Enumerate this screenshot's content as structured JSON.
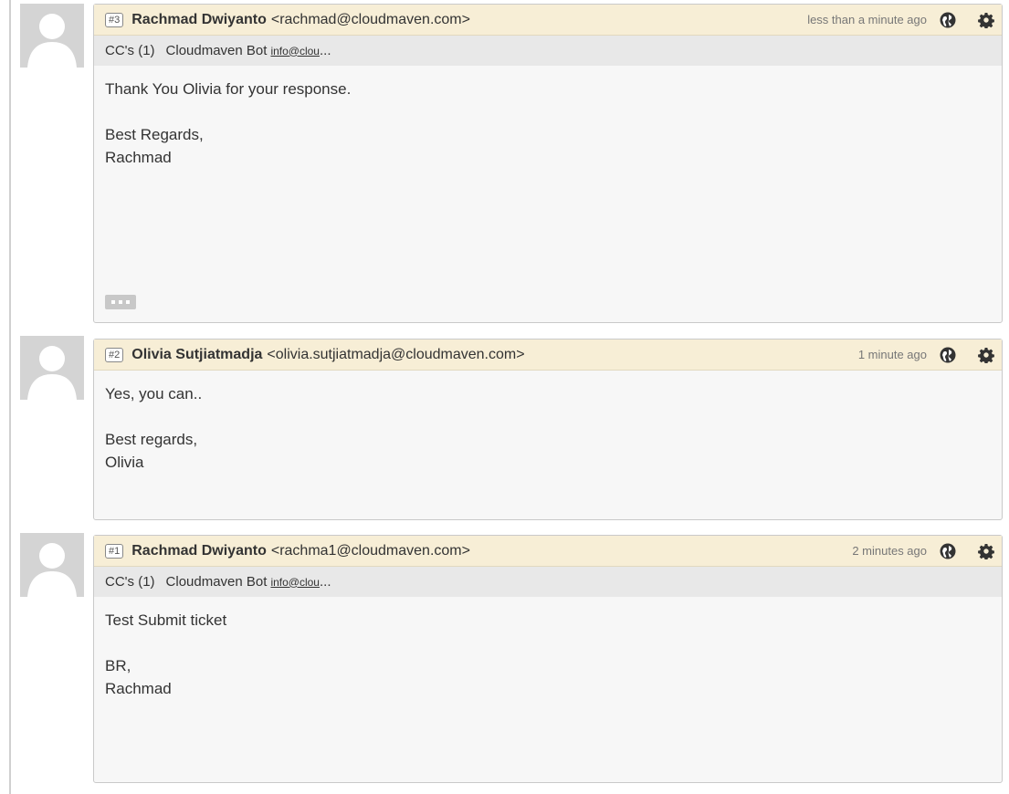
{
  "messages": [
    {
      "number": "#3",
      "author": "Rachmad Dwiyanto",
      "email": "<rachmad@cloudmaven.com>",
      "time": "less than a minute ago",
      "cc_label": "CC's (1)",
      "cc_name": "Cloudmaven Bot",
      "cc_email": "info@clou",
      "cc_more": "...",
      "body": [
        "Thank You Olivia for your response.",
        "",
        "Best Regards,",
        "Rachmad"
      ]
    },
    {
      "number": "#2",
      "author": "Olivia Sutjiatmadja",
      "email": "<olivia.sutjiatmadja@cloudmaven.com>",
      "time": "1 minute ago",
      "body": [
        "Yes, you can..",
        "",
        "Best regards,",
        "Olivia"
      ]
    },
    {
      "number": "#1",
      "author": "Rachmad Dwiyanto",
      "email": "<rachma1@cloudmaven.com>",
      "time": "2 minutes ago",
      "cc_label": "CC's (1)",
      "cc_name": "Cloudmaven Bot",
      "cc_email": "info@clou",
      "cc_more": "...",
      "body": [
        "Test Submit ticket",
        "",
        "BR,",
        "Rachmad"
      ]
    }
  ],
  "icons": {
    "public": "globe-icon",
    "settings": "gear-icon",
    "avatar": "user-avatar-placeholder",
    "expand": "ellipsis-icon"
  },
  "colors": {
    "header_bg": "#f7eed6",
    "cc_bg": "#e8e8e8",
    "body_bg": "#f7f7f7",
    "avatar_bg": "#d4d4d4"
  }
}
